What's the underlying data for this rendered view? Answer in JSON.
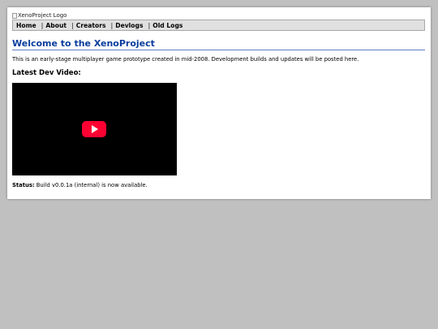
{
  "logo": {
    "alt": "XenoProject Logo"
  },
  "nav": {
    "items": [
      {
        "label": "Home"
      },
      {
        "label": "About"
      },
      {
        "label": "Creators"
      },
      {
        "label": "Devlogs"
      },
      {
        "label": "Old Logs"
      }
    ],
    "separator": "|"
  },
  "main": {
    "heading": "Welcome to the XenoProject",
    "intro": "This is an early-stage multiplayer game prototype created in mid-2008. Development builds and updates will be posted here.",
    "video_heading": "Latest Dev Video:",
    "video": {
      "icon": "play-icon"
    },
    "status": {
      "label": "Status:",
      "text": " Build v0.0.1a (internal) is now available."
    }
  },
  "colors": {
    "background": "#c0c0c0",
    "heading": "#0a3d9c",
    "nav_bar": "#e0e0e0",
    "play_button": "#ff0033"
  }
}
